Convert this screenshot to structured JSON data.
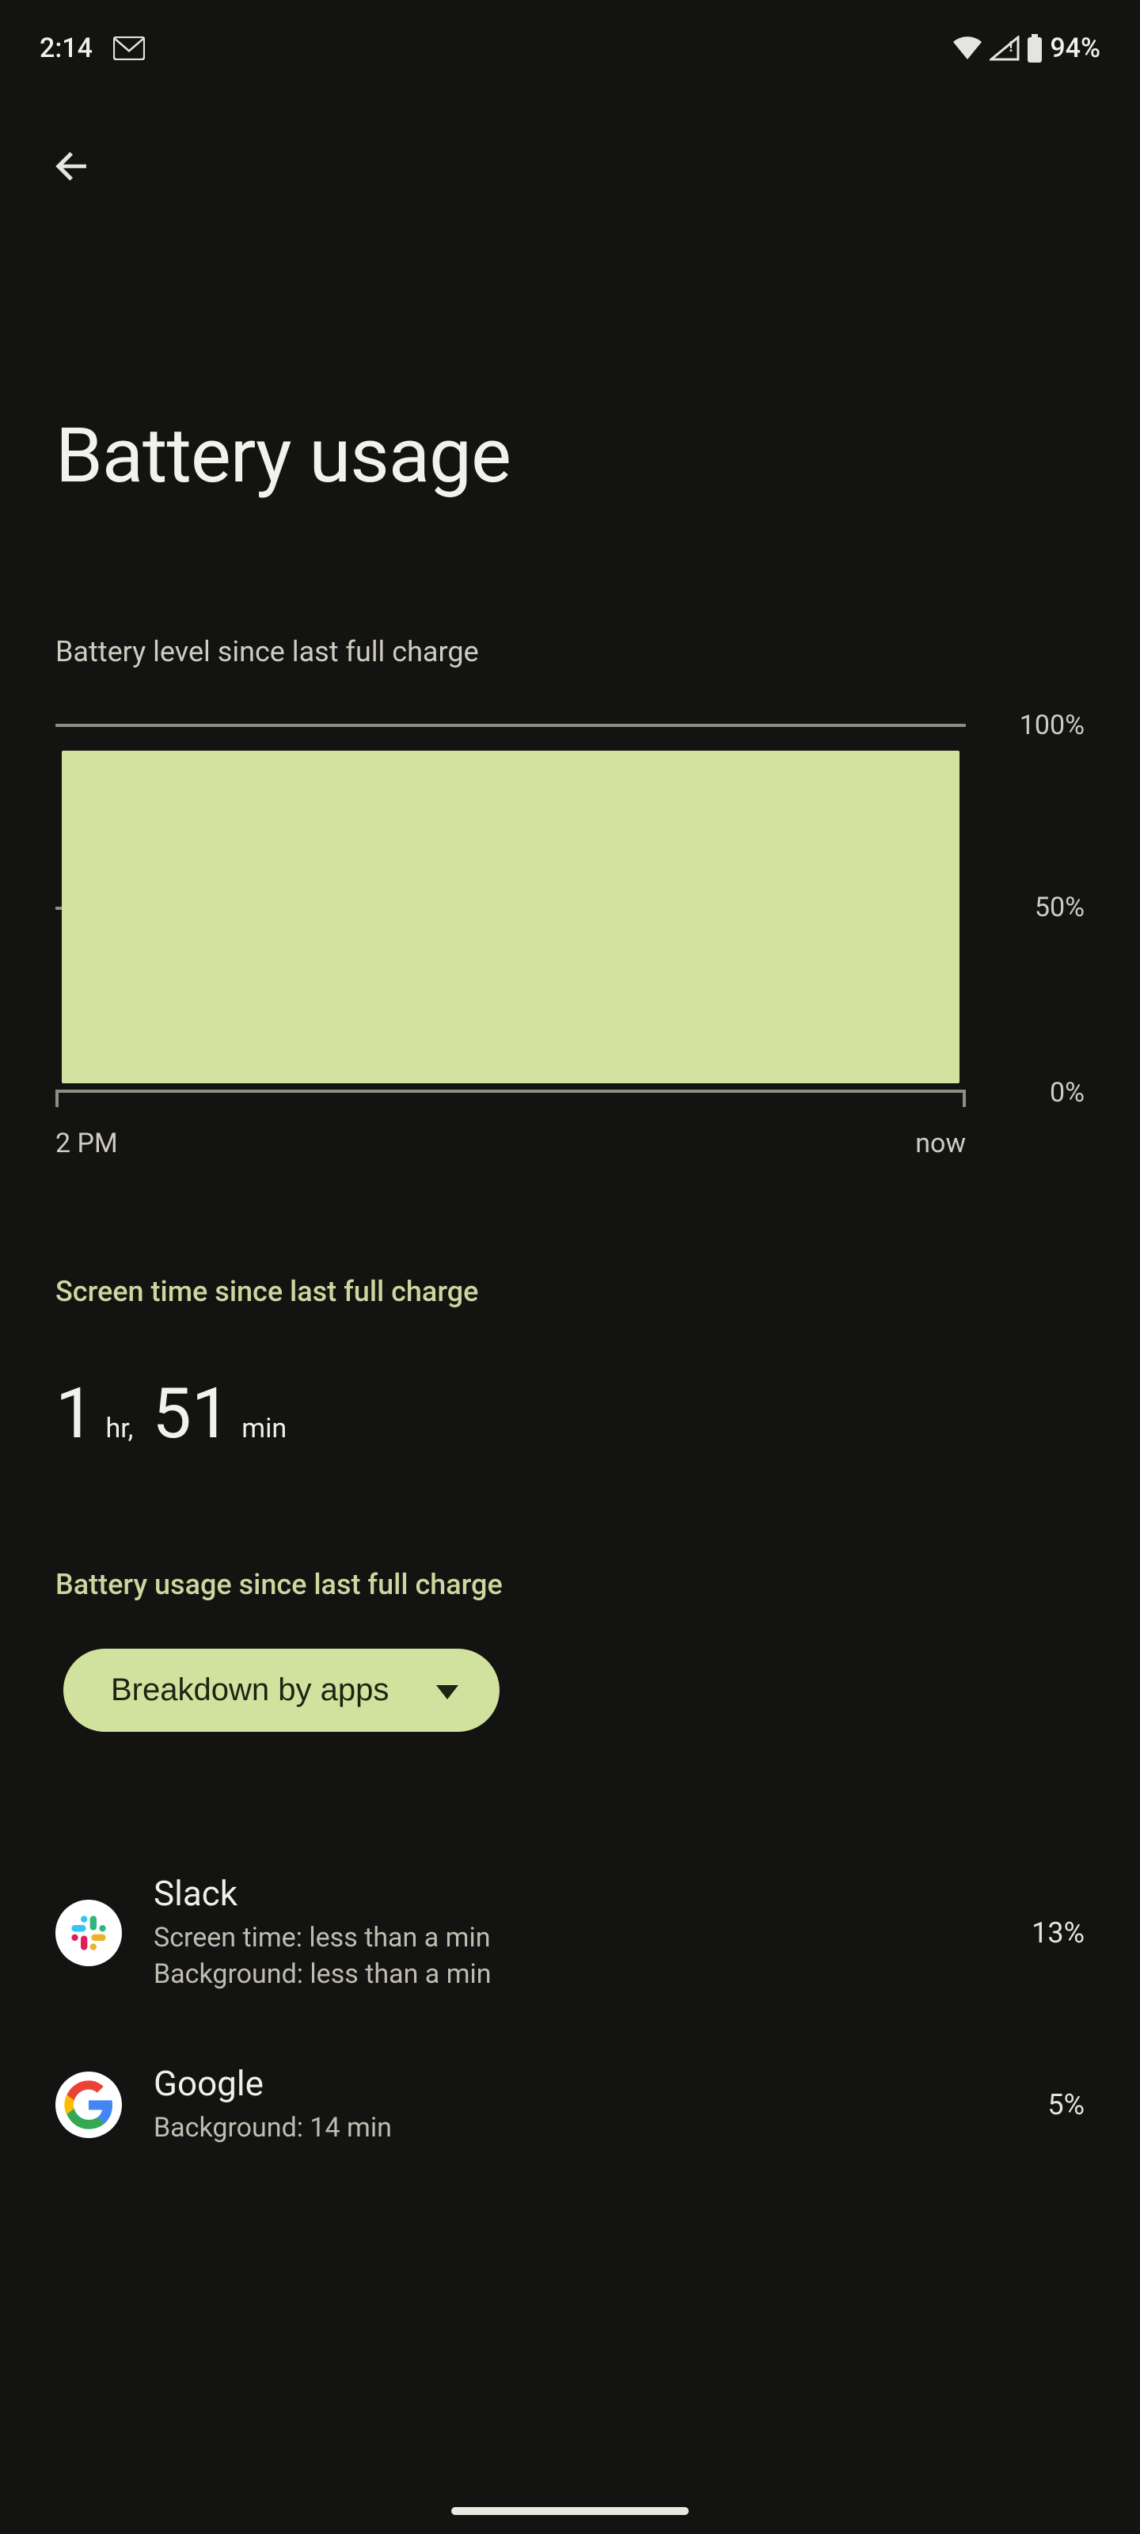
{
  "status_bar": {
    "time": "2:14",
    "battery_text": "94%",
    "icons": {
      "gmail": "gmail-icon",
      "wifi": "wifi-icon",
      "signal": "signal-icon",
      "battery": "battery-icon"
    }
  },
  "header": {
    "back": "back"
  },
  "page": {
    "title": "Battery usage",
    "chart_caption": "Battery level since last full charge",
    "screen_time_header": "Screen time since last full charge",
    "usage_header": "Battery usage since last full charge"
  },
  "screen_time": {
    "hr_num": "1",
    "hr_unit": "hr,",
    "min_num": "51",
    "min_unit": "min"
  },
  "dropdown": {
    "label": "Breakdown by apps"
  },
  "chart_data": {
    "type": "area",
    "title": "Battery level since last full charge",
    "xlabel": "",
    "ylabel": "",
    "ylim": [
      0,
      100
    ],
    "x": [
      "2 PM",
      "now"
    ],
    "values": [
      94,
      94
    ],
    "y_ticks": [
      "100%",
      "50%",
      "0%"
    ],
    "x_ticks": [
      "2 PM",
      "now"
    ]
  },
  "apps": [
    {
      "name": "Slack",
      "line1": "Screen time: less than a min",
      "line2": "Background: less than a min",
      "pct": "13%",
      "icon": "slack"
    },
    {
      "name": "Google",
      "line1": "Background: 14 min",
      "line2": "",
      "pct": "5%",
      "icon": "google"
    }
  ],
  "colors": {
    "accent": "#d1e19e",
    "bg": "#131311",
    "text": "#e6e4de"
  }
}
